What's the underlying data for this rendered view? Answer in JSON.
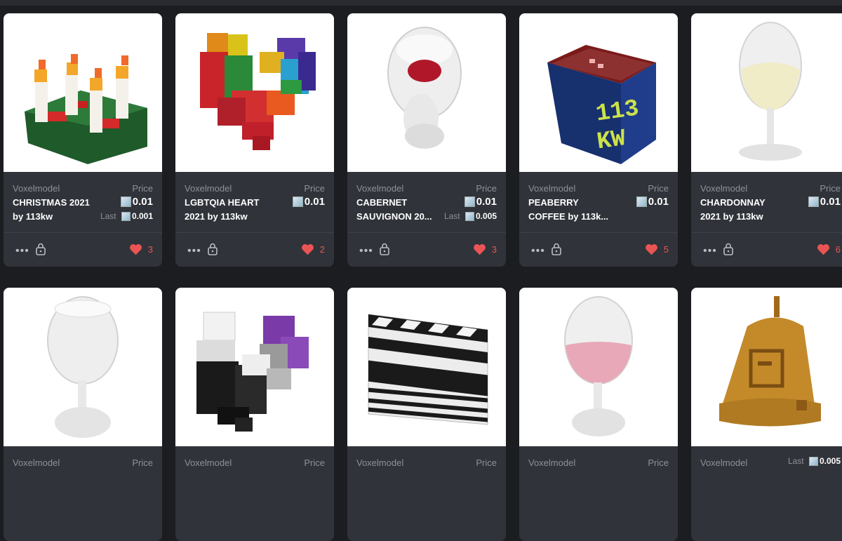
{
  "colors": {
    "background": "#1c1d21",
    "card": "#303339",
    "heart": "#ea5455"
  },
  "labels": {
    "type": "Voxelmodel",
    "price": "Price",
    "last": "Last"
  },
  "row1": [
    {
      "title_l1": "CHRISTMAS 2021",
      "title_l2": "by 113kw",
      "price": "0.01",
      "last": "0.001",
      "likes": "3",
      "art": "wreath"
    },
    {
      "title_l1": "LGBTQIA HEART",
      "title_l2": "2021 by 113kw",
      "price": "0.01",
      "last": "",
      "likes": "2",
      "art": "rainbow-heart"
    },
    {
      "title_l1": "CABERNET",
      "title_l2": "SAUVIGNON 20...",
      "price": "0.01",
      "last": "0.005",
      "likes": "3",
      "art": "red-wine-glass"
    },
    {
      "title_l1": "PEABERRY",
      "title_l2": "COFFEE by 113k...",
      "price": "0.01",
      "last": "",
      "likes": "5",
      "art": "coffee-bag"
    },
    {
      "title_l1": "CHARDONNAY",
      "title_l2": "2021 by 113kw",
      "price": "0.01",
      "last": "",
      "likes": "6",
      "art": "white-wine-glass"
    }
  ],
  "row2": [
    {
      "price_label": "Price",
      "last": "",
      "art": "empty-wine-glass"
    },
    {
      "price_label": "Price",
      "last": "",
      "art": "ace-heart"
    },
    {
      "price_label": "Price",
      "last": "",
      "art": "clapperboard"
    },
    {
      "price_label": "Price",
      "last": "",
      "art": "rose-wine-glass"
    },
    {
      "price_label": "",
      "last": "0.005",
      "art": "golden-bell"
    }
  ]
}
